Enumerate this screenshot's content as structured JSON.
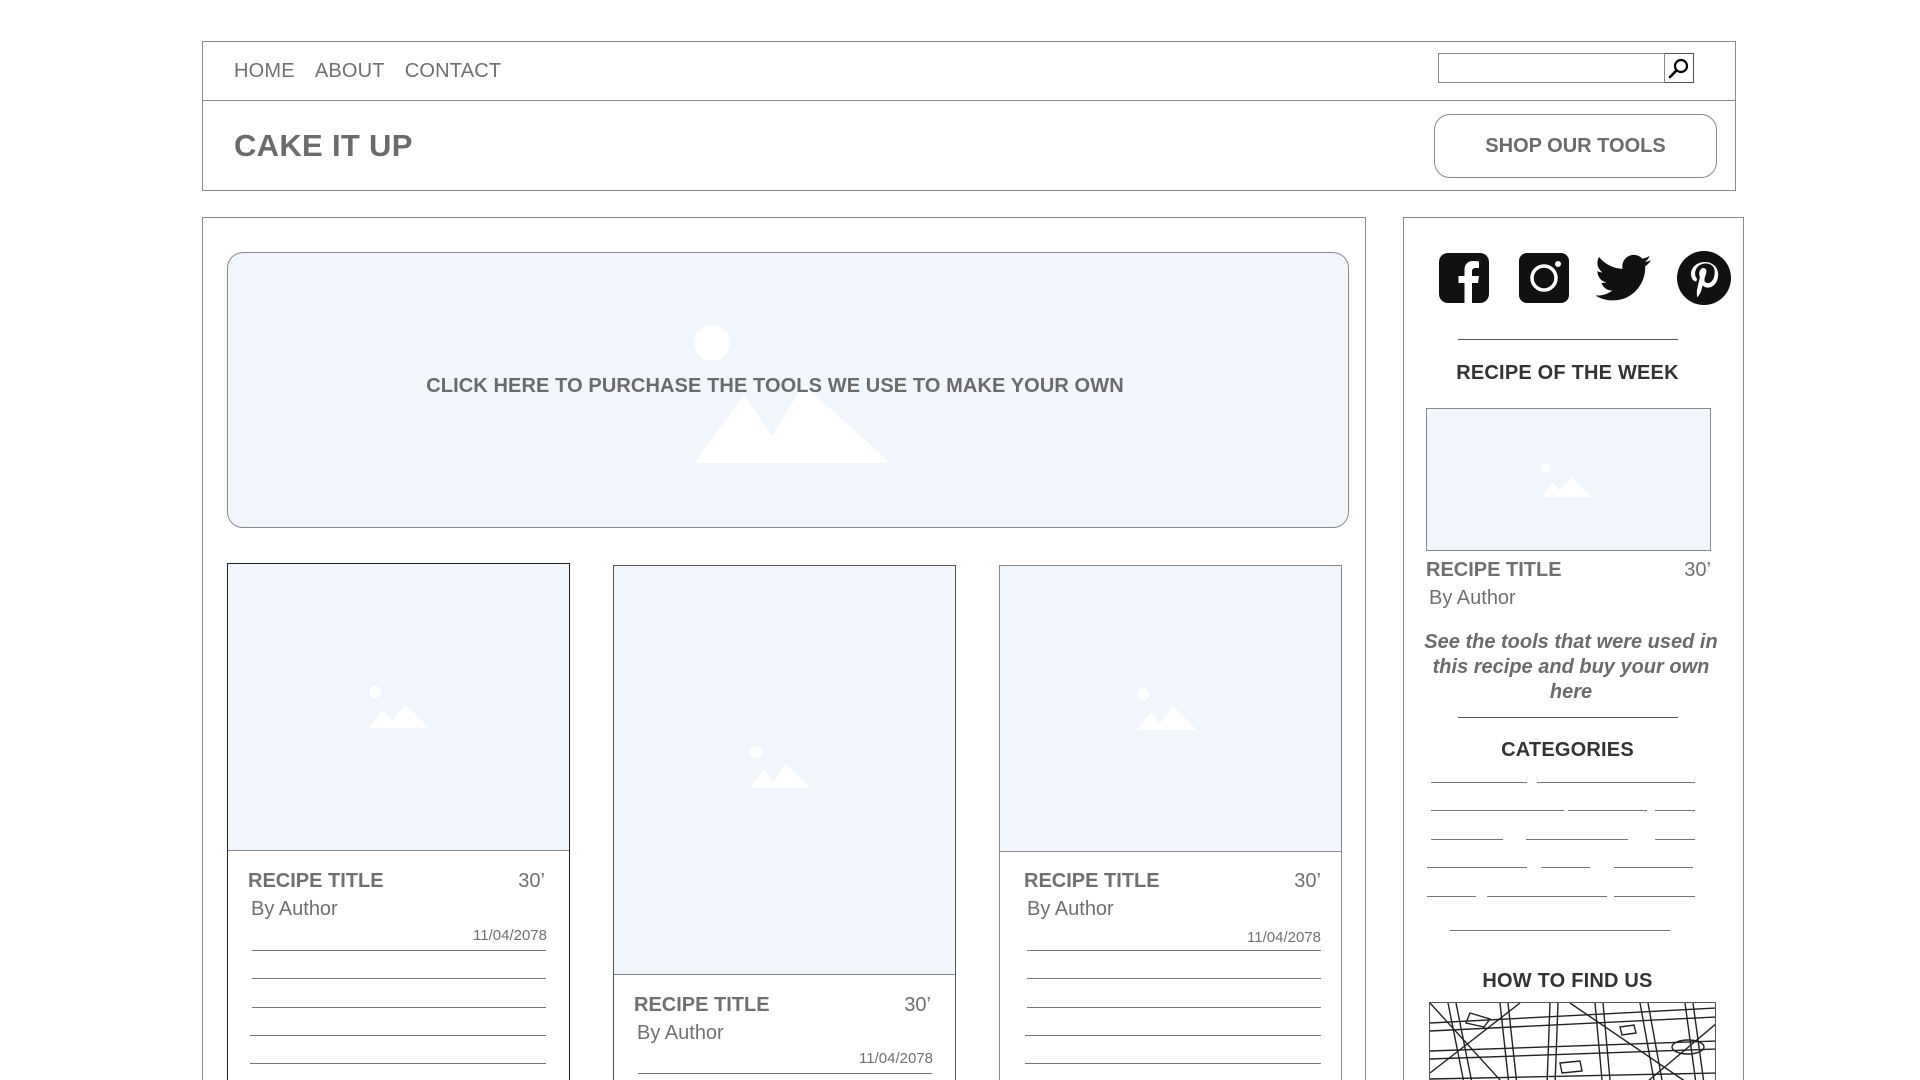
{
  "nav": {
    "links": [
      "HOME",
      "ABOUT",
      "CONTACT"
    ],
    "search": {
      "value": "",
      "placeholder": ""
    }
  },
  "header": {
    "brand": "CAKE IT UP",
    "shop_button": "SHOP OUR TOOLS"
  },
  "hero": {
    "text": "CLICK HERE TO PURCHASE THE TOOLS WE USE TO MAKE YOUR OWN"
  },
  "cards": [
    {
      "title": "RECIPE TITLE",
      "time": "30’",
      "author": "By Author",
      "date": "11/04/2078"
    },
    {
      "title": "RECIPE TITLE",
      "time": "30’",
      "author": "By Author",
      "date": "11/04/2078"
    },
    {
      "title": "RECIPE TITLE",
      "time": "30’",
      "author": "By Author",
      "date": "11/04/2078"
    }
  ],
  "sidebar": {
    "social": [
      "facebook-icon",
      "instagram-icon",
      "twitter-icon",
      "pinterest-icon"
    ],
    "recipe_of_week": {
      "heading": "RECIPE OF THE WEEK",
      "title": "RECIPE TITLE",
      "time": "30’",
      "author": "By Author",
      "note": "See the tools that were used in this recipe and buy your own here"
    },
    "categories_heading": "CATEGORIES",
    "find_us_heading": "HOW TO FIND US"
  },
  "colors": {
    "placeholder_fill": "#f1f6fc",
    "border": "#8a8a8a",
    "text": "#6b6b6b"
  }
}
